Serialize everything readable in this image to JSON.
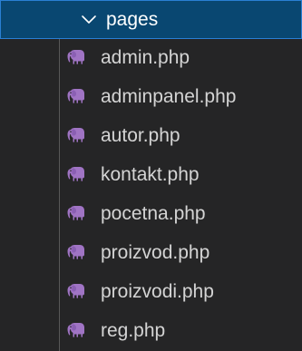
{
  "explorer": {
    "folder": {
      "label": "pages",
      "icon": "chevron-down-icon",
      "expanded": true
    },
    "files": [
      {
        "label": "admin.php",
        "icon": "php-elephant-icon"
      },
      {
        "label": "adminpanel.php",
        "icon": "php-elephant-icon"
      },
      {
        "label": "autor.php",
        "icon": "php-elephant-icon"
      },
      {
        "label": "kontakt.php",
        "icon": "php-elephant-icon"
      },
      {
        "label": "pocetna.php",
        "icon": "php-elephant-icon"
      },
      {
        "label": "proizvod.php",
        "icon": "php-elephant-icon"
      },
      {
        "label": "proizvodi.php",
        "icon": "php-elephant-icon"
      },
      {
        "label": "reg.php",
        "icon": "php-elephant-icon"
      }
    ]
  },
  "colors": {
    "background": "#252526",
    "selected_row": "#094771",
    "selected_border": "#2a7fd4",
    "text": "#d4d4d4",
    "selected_text": "#ffffff",
    "php_icon": "#a074c4",
    "indent_guide": "#585858"
  }
}
